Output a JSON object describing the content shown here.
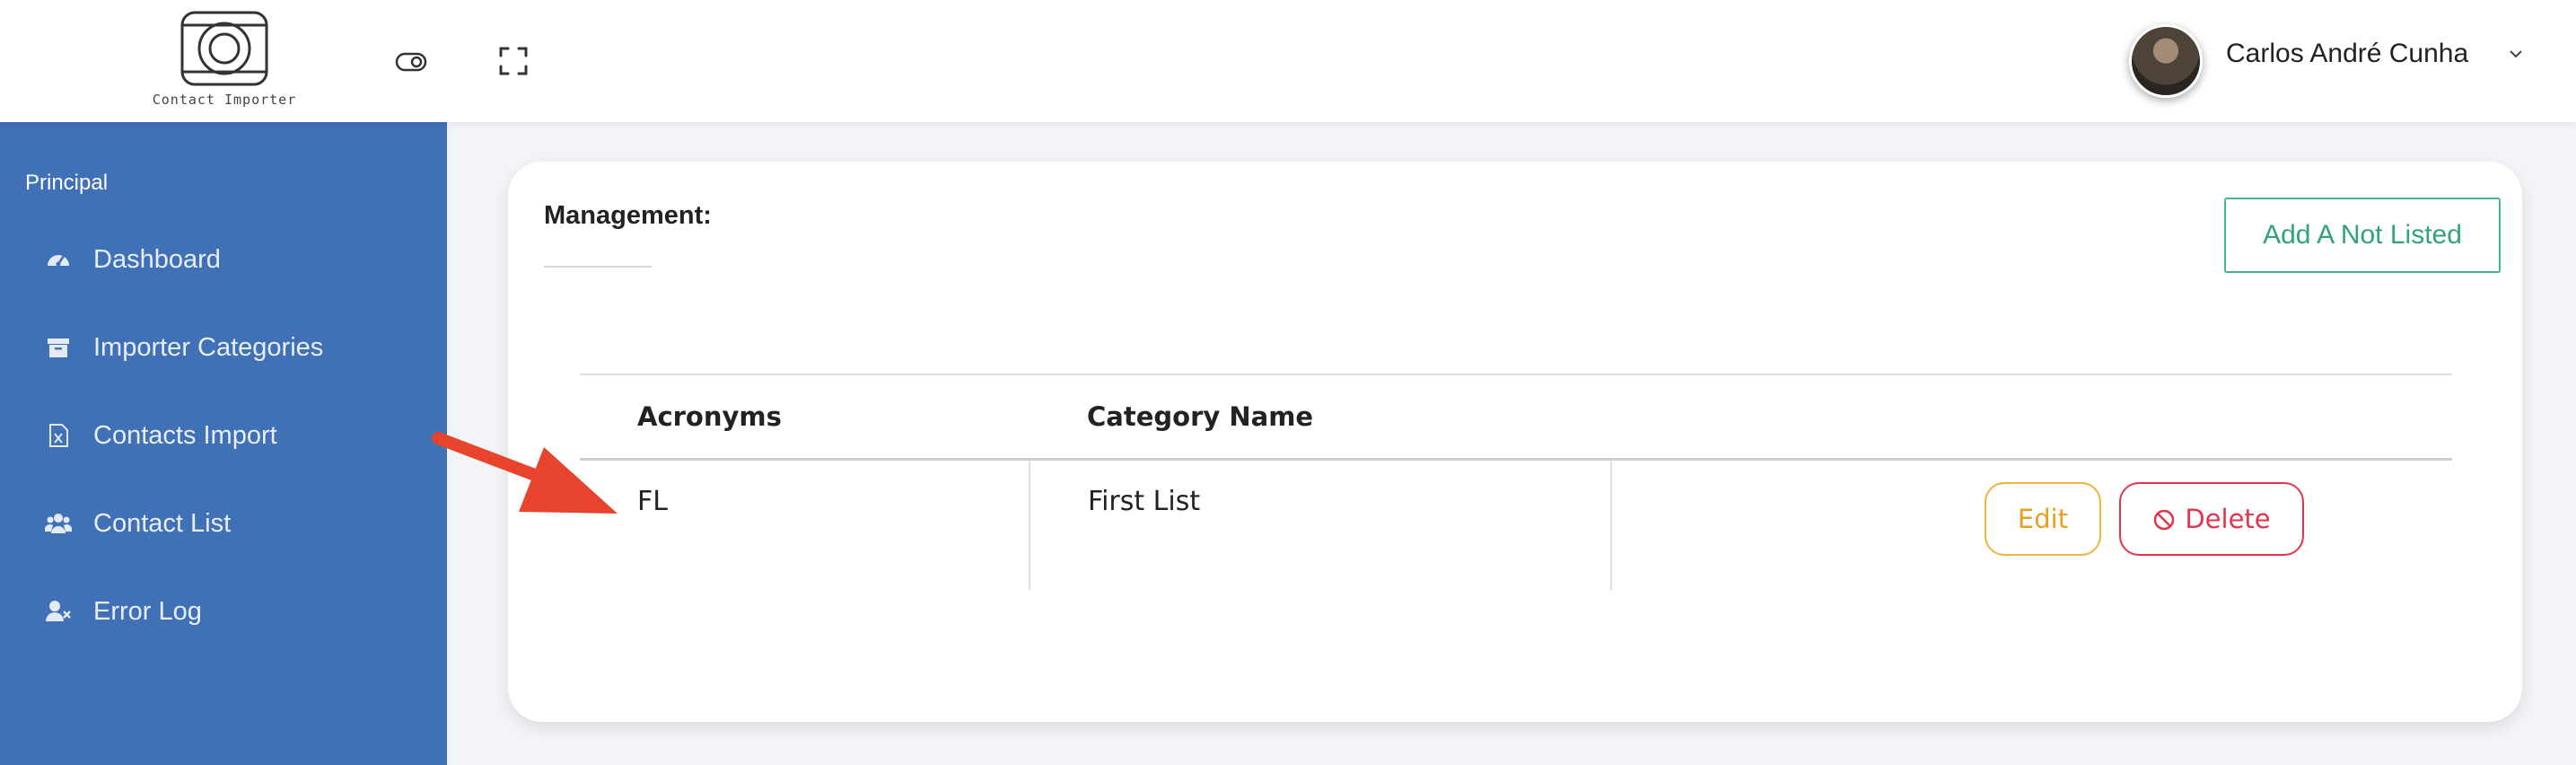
{
  "header": {
    "logo_text": "Contact Importer",
    "user_name": "Carlos André Cunha"
  },
  "sidebar": {
    "section_title": "Principal",
    "items": [
      {
        "label": "Dashboard",
        "icon": "dashboard-icon"
      },
      {
        "label": "Importer Categories",
        "icon": "archive-icon"
      },
      {
        "label": "Contacts Import",
        "icon": "excel-file-icon"
      },
      {
        "label": "Contact List",
        "icon": "users-icon"
      },
      {
        "label": "Error Log",
        "icon": "user-x-icon"
      }
    ]
  },
  "main": {
    "title": "Management:",
    "add_button": "Add A Not Listed",
    "table": {
      "headers": [
        "Acronyms",
        "Category Name",
        ""
      ],
      "rows": [
        {
          "acronym": "FL",
          "category_name": "First List",
          "edit_label": "Edit",
          "delete_label": "Delete"
        }
      ]
    }
  },
  "colors": {
    "sidebar": "#4070b6",
    "add_button": "#3fb98b",
    "edit": "#f0b23a",
    "delete": "#e2344a",
    "annotation_arrow": "#e8432c"
  }
}
